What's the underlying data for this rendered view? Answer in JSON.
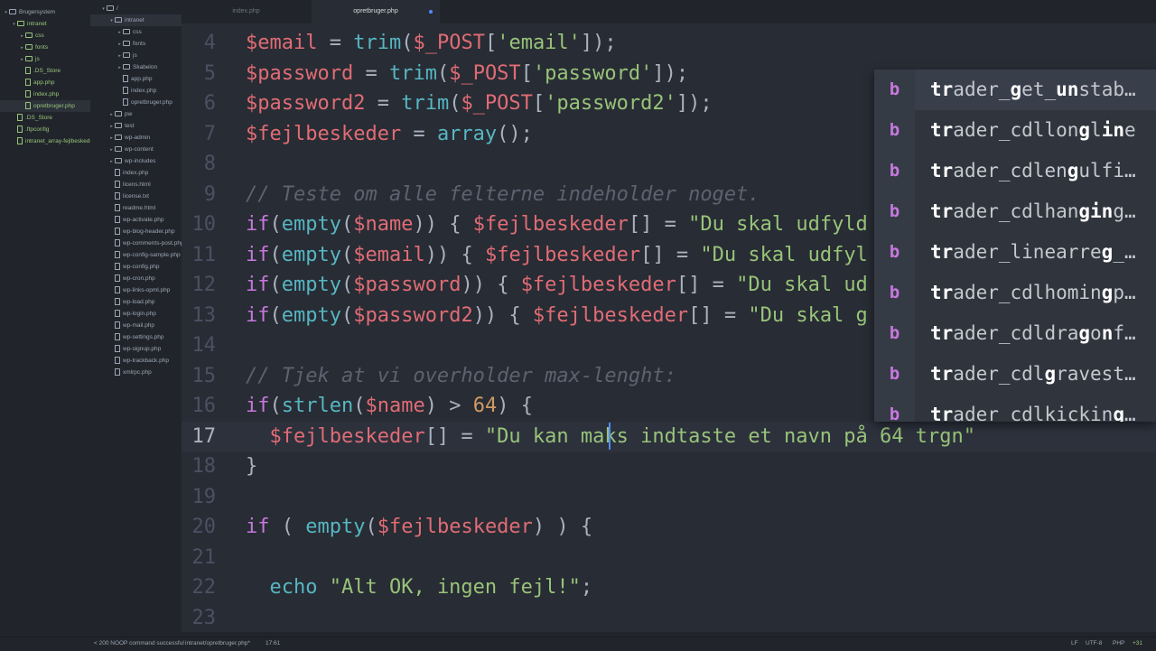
{
  "left_panel": {
    "items": [
      {
        "label": "Brugersystem",
        "depth": 0,
        "kind": "folder",
        "open": true,
        "color": "#9da5b4"
      },
      {
        "label": "intranet",
        "depth": 1,
        "kind": "folder",
        "open": true,
        "color": "#98c379"
      },
      {
        "label": "css",
        "depth": 2,
        "kind": "folder",
        "open": false,
        "color": "#98c379"
      },
      {
        "label": "fonts",
        "depth": 2,
        "kind": "folder",
        "open": false,
        "color": "#98c379"
      },
      {
        "label": "js",
        "depth": 2,
        "kind": "folder",
        "open": false,
        "color": "#98c379"
      },
      {
        "label": ".DS_Store",
        "depth": 2,
        "kind": "file",
        "color": "#98c379"
      },
      {
        "label": "app.php",
        "depth": 2,
        "kind": "file",
        "color": "#98c379"
      },
      {
        "label": "index.php",
        "depth": 2,
        "kind": "file",
        "color": "#98c379"
      },
      {
        "label": "opretbruger.php",
        "depth": 2,
        "kind": "file",
        "color": "#98c379",
        "selected": true
      },
      {
        "label": ".DS_Store",
        "depth": 1,
        "kind": "file",
        "color": "#98c379"
      },
      {
        "label": ".ftpconfig",
        "depth": 1,
        "kind": "file",
        "color": "#98c379"
      },
      {
        "label": "intranet_array-fejlbeskeder",
        "depth": 1,
        "kind": "file",
        "color": "#98c379"
      }
    ]
  },
  "right_panel": {
    "items": [
      {
        "label": "/",
        "depth": 0,
        "kind": "folder",
        "open": true
      },
      {
        "label": "intranet",
        "depth": 1,
        "kind": "folder",
        "open": true,
        "selected": true
      },
      {
        "label": "css",
        "depth": 2,
        "kind": "folder",
        "open": false
      },
      {
        "label": "fonts",
        "depth": 2,
        "kind": "folder",
        "open": false
      },
      {
        "label": "js",
        "depth": 2,
        "kind": "folder",
        "open": false
      },
      {
        "label": "Skabelon",
        "depth": 2,
        "kind": "folder",
        "open": false
      },
      {
        "label": "app.php",
        "depth": 2,
        "kind": "file"
      },
      {
        "label": "index.php",
        "depth": 2,
        "kind": "file"
      },
      {
        "label": "opretbruger.php",
        "depth": 2,
        "kind": "file"
      },
      {
        "label": "pw",
        "depth": 1,
        "kind": "folder",
        "open": false
      },
      {
        "label": "test",
        "depth": 1,
        "kind": "folder",
        "open": false
      },
      {
        "label": "wp-admin",
        "depth": 1,
        "kind": "folder",
        "open": false
      },
      {
        "label": "wp-content",
        "depth": 1,
        "kind": "folder",
        "open": false
      },
      {
        "label": "wp-includes",
        "depth": 1,
        "kind": "folder",
        "open": false
      },
      {
        "label": "index.php",
        "depth": 1,
        "kind": "file"
      },
      {
        "label": "licens.html",
        "depth": 1,
        "kind": "file"
      },
      {
        "label": "license.txt",
        "depth": 1,
        "kind": "file"
      },
      {
        "label": "readme.html",
        "depth": 1,
        "kind": "file"
      },
      {
        "label": "wp-activate.php",
        "depth": 1,
        "kind": "file"
      },
      {
        "label": "wp-blog-header.php",
        "depth": 1,
        "kind": "file"
      },
      {
        "label": "wp-comments-post.php",
        "depth": 1,
        "kind": "file"
      },
      {
        "label": "wp-config-sample.php",
        "depth": 1,
        "kind": "file"
      },
      {
        "label": "wp-config.php",
        "depth": 1,
        "kind": "file"
      },
      {
        "label": "wp-cron.php",
        "depth": 1,
        "kind": "file"
      },
      {
        "label": "wp-links-opml.php",
        "depth": 1,
        "kind": "file"
      },
      {
        "label": "wp-load.php",
        "depth": 1,
        "kind": "file"
      },
      {
        "label": "wp-login.php",
        "depth": 1,
        "kind": "file"
      },
      {
        "label": "wp-mail.php",
        "depth": 1,
        "kind": "file"
      },
      {
        "label": "wp-settings.php",
        "depth": 1,
        "kind": "file"
      },
      {
        "label": "wp-signup.php",
        "depth": 1,
        "kind": "file"
      },
      {
        "label": "wp-trackback.php",
        "depth": 1,
        "kind": "file"
      },
      {
        "label": "xmlrpc.php",
        "depth": 1,
        "kind": "file"
      }
    ]
  },
  "tabs": [
    {
      "label": "index.php",
      "active": false
    },
    {
      "label": "opretbruger.php",
      "active": true,
      "modified": true
    }
  ],
  "code_lines": [
    {
      "n": "4",
      "tokens": [
        [
          "$email",
          "var"
        ],
        [
          " = ",
          "op"
        ],
        [
          "trim",
          "fn"
        ],
        [
          "(",
          "op"
        ],
        [
          "$_POST",
          "var"
        ],
        [
          "[",
          "op"
        ],
        [
          "'email'",
          "str"
        ],
        [
          "]);",
          "op"
        ]
      ]
    },
    {
      "n": "5",
      "tokens": [
        [
          "$password",
          "var"
        ],
        [
          " = ",
          "op"
        ],
        [
          "trim",
          "fn"
        ],
        [
          "(",
          "op"
        ],
        [
          "$_POST",
          "var"
        ],
        [
          "[",
          "op"
        ],
        [
          "'password'",
          "str"
        ],
        [
          "]);",
          "op"
        ]
      ]
    },
    {
      "n": "6",
      "tokens": [
        [
          "$password2",
          "var"
        ],
        [
          " = ",
          "op"
        ],
        [
          "trim",
          "fn"
        ],
        [
          "(",
          "op"
        ],
        [
          "$_POST",
          "var"
        ],
        [
          "[",
          "op"
        ],
        [
          "'password2'",
          "str"
        ],
        [
          "]);",
          "op"
        ]
      ]
    },
    {
      "n": "7",
      "tokens": [
        [
          "$fejlbeskeder",
          "var"
        ],
        [
          " = ",
          "op"
        ],
        [
          "array",
          "fn"
        ],
        [
          "();",
          "op"
        ]
      ]
    },
    {
      "n": "8",
      "tokens": []
    },
    {
      "n": "9",
      "tokens": [
        [
          "// Teste om alle felterne indeholder noget.",
          "cm"
        ]
      ]
    },
    {
      "n": "10",
      "tokens": [
        [
          "if",
          "kw"
        ],
        [
          "(",
          "op"
        ],
        [
          "empty",
          "fn"
        ],
        [
          "(",
          "op"
        ],
        [
          "$name",
          "var"
        ],
        [
          ")) { ",
          "op"
        ],
        [
          "$fejlbeskeder",
          "var"
        ],
        [
          "[] = ",
          "op"
        ],
        [
          "\"Du skal udfyld",
          "str"
        ]
      ]
    },
    {
      "n": "11",
      "tokens": [
        [
          "if",
          "kw"
        ],
        [
          "(",
          "op"
        ],
        [
          "empty",
          "fn"
        ],
        [
          "(",
          "op"
        ],
        [
          "$email",
          "var"
        ],
        [
          ")) { ",
          "op"
        ],
        [
          "$fejlbeskeder",
          "var"
        ],
        [
          "[] = ",
          "op"
        ],
        [
          "\"Du skal udfyl",
          "str"
        ]
      ]
    },
    {
      "n": "12",
      "tokens": [
        [
          "if",
          "kw"
        ],
        [
          "(",
          "op"
        ],
        [
          "empty",
          "fn"
        ],
        [
          "(",
          "op"
        ],
        [
          "$password",
          "var"
        ],
        [
          ")) { ",
          "op"
        ],
        [
          "$fejlbeskeder",
          "var"
        ],
        [
          "[] = ",
          "op"
        ],
        [
          "\"Du skal ud",
          "str"
        ]
      ]
    },
    {
      "n": "13",
      "tokens": [
        [
          "if",
          "kw"
        ],
        [
          "(",
          "op"
        ],
        [
          "empty",
          "fn"
        ],
        [
          "(",
          "op"
        ],
        [
          "$password2",
          "var"
        ],
        [
          ")) { ",
          "op"
        ],
        [
          "$fejlbeskeder",
          "var"
        ],
        [
          "[] = ",
          "op"
        ],
        [
          "\"Du skal g",
          "str"
        ]
      ]
    },
    {
      "n": "14",
      "tokens": []
    },
    {
      "n": "15",
      "tokens": [
        [
          "// Tjek at vi overholder max-lenght:",
          "cm"
        ]
      ]
    },
    {
      "n": "16",
      "tokens": [
        [
          "if",
          "kw"
        ],
        [
          "(",
          "op"
        ],
        [
          "strlen",
          "fn"
        ],
        [
          "(",
          "op"
        ],
        [
          "$name",
          "var"
        ],
        [
          ") > ",
          "op"
        ],
        [
          "64",
          "num"
        ],
        [
          ") {",
          "op"
        ]
      ]
    },
    {
      "n": "17",
      "current": true,
      "tokens": [
        [
          "  ",
          "op"
        ],
        [
          "$fejlbeskeder",
          "var"
        ],
        [
          "[] = ",
          "op"
        ],
        [
          "\"Du kan maks indtaste et navn på 64 trgn\"",
          "str"
        ]
      ]
    },
    {
      "n": "18",
      "tokens": [
        [
          "}",
          "op"
        ]
      ]
    },
    {
      "n": "19",
      "tokens": []
    },
    {
      "n": "20",
      "tokens": [
        [
          "if",
          "kw"
        ],
        [
          " ( ",
          "op"
        ],
        [
          "empty",
          "fn"
        ],
        [
          "(",
          "op"
        ],
        [
          "$fejlbeskeder",
          "var"
        ],
        [
          ") ) {",
          "op"
        ]
      ]
    },
    {
      "n": "21",
      "tokens": []
    },
    {
      "n": "22",
      "tokens": [
        [
          "  ",
          "op"
        ],
        [
          "echo",
          "fn"
        ],
        [
          " ",
          "op"
        ],
        [
          "\"Alt OK, ingen fejl!\"",
          "str"
        ],
        [
          ";",
          "op"
        ]
      ]
    },
    {
      "n": "23",
      "tokens": []
    }
  ],
  "autocomplete": {
    "badge": "b",
    "items": [
      [
        [
          "tr",
          true
        ],
        [
          "ader_",
          false
        ],
        [
          "g",
          true
        ],
        [
          "et_",
          false
        ],
        [
          "un",
          true
        ],
        [
          "stab…",
          false
        ]
      ],
      [
        [
          "tr",
          true
        ],
        [
          "ader_cdllon",
          false
        ],
        [
          "g",
          true
        ],
        [
          "l",
          false
        ],
        [
          "in",
          true
        ],
        [
          "e",
          false
        ]
      ],
      [
        [
          "tr",
          true
        ],
        [
          "ader_cdlen",
          false
        ],
        [
          "g",
          true
        ],
        [
          "ulfi…",
          false
        ]
      ],
      [
        [
          "tr",
          true
        ],
        [
          "ader_cdlhan",
          false
        ],
        [
          "gin",
          true
        ],
        [
          "g…",
          false
        ]
      ],
      [
        [
          "tr",
          true
        ],
        [
          "ader_linearre",
          false
        ],
        [
          "g",
          true
        ],
        [
          "_…",
          false
        ]
      ],
      [
        [
          "tr",
          true
        ],
        [
          "ader_cdlhomin",
          false
        ],
        [
          "g",
          true
        ],
        [
          "p…",
          false
        ]
      ],
      [
        [
          "tr",
          true
        ],
        [
          "ader_cdldra",
          false
        ],
        [
          "g",
          true
        ],
        [
          "o",
          false
        ],
        [
          "n",
          true
        ],
        [
          "f…",
          false
        ]
      ],
      [
        [
          "tr",
          true
        ],
        [
          "ader_cdl",
          false
        ],
        [
          "g",
          true
        ],
        [
          "ravest…",
          false
        ]
      ],
      [
        [
          "tr",
          true
        ],
        [
          "ader_cdlkickin",
          false
        ],
        [
          "g",
          true
        ],
        [
          "…",
          false
        ]
      ]
    ]
  },
  "status": {
    "message": "< 200 NOOP command successful",
    "path": "intranet/opretbruger.php*",
    "position": "17:61",
    "line_ending": "LF",
    "encoding": "UTF-8",
    "grammar": "PHP",
    "git": "+31"
  }
}
